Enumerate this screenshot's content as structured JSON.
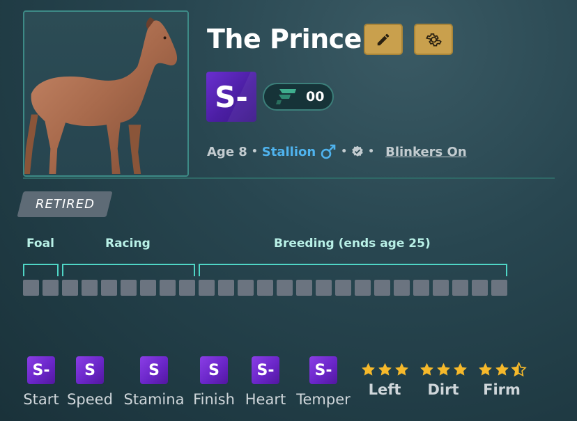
{
  "horse": {
    "name": "The Prince",
    "grade": "S-",
    "points_value": "00",
    "age_text": "Age 8",
    "sex": "Stallion",
    "blinkers": "Blinkers On",
    "status": "RETIRED"
  },
  "lifecycle": {
    "phases": [
      "Foal",
      "Racing",
      "Breeding (ends age 25)"
    ],
    "total_segments": 25
  },
  "stats": [
    {
      "label": "Start",
      "grade": "S-"
    },
    {
      "label": "Speed",
      "grade": "S"
    },
    {
      "label": "Stamina",
      "grade": "S"
    },
    {
      "label": "Finish",
      "grade": "S"
    },
    {
      "label": "Heart",
      "grade": "S-"
    },
    {
      "label": "Temper",
      "grade": "S-"
    }
  ],
  "preferences": [
    {
      "label": "Left",
      "stars": 3
    },
    {
      "label": "Dirt",
      "stars": 3
    },
    {
      "label": "Firm",
      "stars": 2.5
    }
  ],
  "colors": {
    "accent_gold": "#c9a04d",
    "grade_purple": "#6a26c8",
    "teal": "#4fd6c6",
    "sex_blue": "#4fb3ee",
    "star": "#f6b92b"
  },
  "icons": [
    "pencil-icon",
    "gear-icon",
    "brand-f-icon",
    "male-symbol-icon",
    "verified-icon",
    "star-icon"
  ]
}
